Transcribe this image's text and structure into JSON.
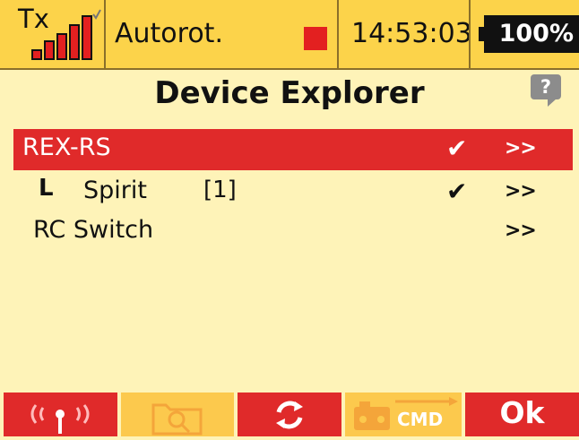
{
  "status_bar": {
    "tx_label": "Tx",
    "model_name": "Autorot.",
    "clock": "14:53:03",
    "battery": "100%"
  },
  "page": {
    "title": "Device Explorer",
    "help_icon": "?"
  },
  "devices": [
    {
      "name": "REX-RS",
      "index": "",
      "checked": "✔",
      "arrow": ">>",
      "selected": true,
      "child": false
    },
    {
      "name": "Spirit",
      "index": "[1]",
      "checked": "✔",
      "arrow": ">>",
      "selected": false,
      "child": true,
      "tree_glyph": "L"
    },
    {
      "name": "RC Switch",
      "index": "",
      "checked": "",
      "arrow": ">>",
      "selected": false,
      "child": false
    }
  ],
  "toolbar": {
    "buttons": [
      {
        "icon": "wireless-broadcast-icon",
        "state": "active"
      },
      {
        "icon": "folder-search-icon",
        "state": "disabled"
      },
      {
        "icon": "refresh-icon",
        "state": "active"
      },
      {
        "icon": "transmitter-cmd-icon",
        "state": "disabled",
        "label": "CMD"
      },
      {
        "icon": "ok",
        "state": "active",
        "label": "Ok"
      }
    ]
  },
  "colors": {
    "background": "#fef3b8",
    "status_bar": "#fcd34a",
    "selection": "#e02a2a",
    "disabled_button": "#fcc94d"
  }
}
